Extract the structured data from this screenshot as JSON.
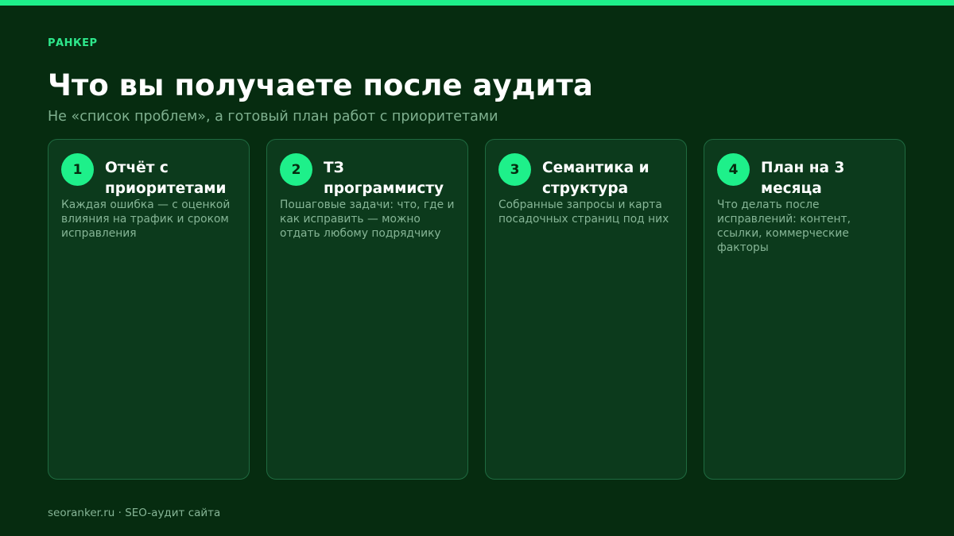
{
  "brand": "РАНКЕР",
  "title": "Что вы получаете после аудита",
  "subtitle": "Не «список проблем», а готовый план работ с приоритетами",
  "cards": [
    {
      "number": "1",
      "title": "Отчёт с приоритетами",
      "description": "Каждая ошибка — с оценкой влияния на трафик и сроком исправления"
    },
    {
      "number": "2",
      "title": "ТЗ программисту",
      "description": "Пошаговые задачи: что, где и как исправить — можно отдать любому подрядчику"
    },
    {
      "number": "3",
      "title": "Семантика и структура",
      "description": "Собранные запросы и карта посадочных страниц под них"
    },
    {
      "number": "4",
      "title": "План на 3 месяца",
      "description": "Что делать после исправлений: контент, ссылки, коммерческие факторы"
    }
  ],
  "footer": "seoranker.ru · SEO-аудит сайта",
  "colors": {
    "background": "#062c10",
    "accent": "#1ef08a",
    "card_background": "#0c3a1c",
    "card_border": "#1f6a40"
  }
}
